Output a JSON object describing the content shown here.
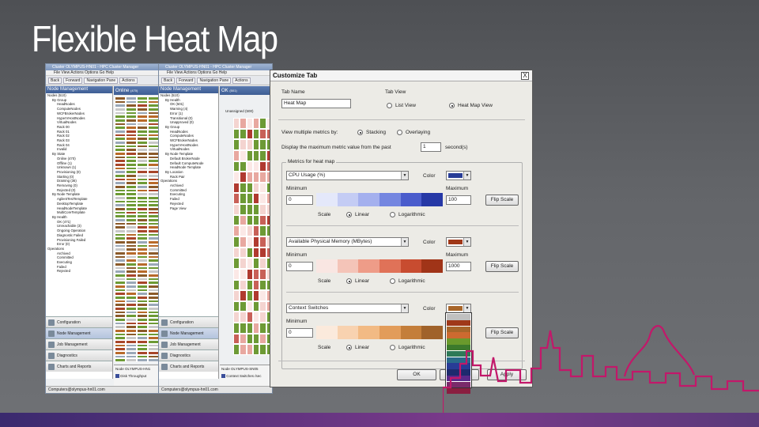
{
  "slide": {
    "title": "Flexible Heat Map"
  },
  "win1": {
    "title": "Cluster OLYMPUS-HN01 - HPC Cluster Manager",
    "menu": "File  View  Actions  Options  Go  Help",
    "toolbar": [
      "Back",
      "Forward",
      "Navigation Pane",
      "Actions",
      "Filters"
    ],
    "nav_header": "Node Management",
    "tree": [
      "Nodes (510)",
      "By Group",
      "HeadNodes",
      "ComputeNodes",
      "WCFBrokerNodes",
      "HyperVHostNodes",
      "VirtualNodes",
      "Rack 00",
      "Rack 01",
      "Rack 02",
      "Rack 03",
      "Rack 04",
      "Invalid",
      "By State",
      "Online (470)",
      "Offline (1)",
      "Unknown (1)",
      "Provisioning (0)",
      "Starting (0)",
      "Draining (36)",
      "Removing (0)",
      "Rejected (0)",
      "By Node Template",
      "AgilentTestTemplate",
      "DesktopTemplate",
      "HeadNodeTemplate",
      "MultiCoreTemplate",
      "By Health",
      "OK (471)",
      "Unreachable (3)",
      "Ongoing Operation",
      "Diagnostic Failed",
      "Provisioning Failed",
      "Error (0)",
      "Operations",
      "Archived",
      "Committed",
      "Executing",
      "Failed",
      "Rejected"
    ],
    "grid_header": "Online",
    "grid_count": "(470)",
    "nav_buttons": [
      "Configuration",
      "Node Management",
      "Job Management",
      "Diagnostics",
      "Charts and Reports"
    ],
    "node_label": "Node",
    "node_value": "OLYMPUS-HN1",
    "legend": "Disk Throughput",
    "status": "Computers@olympus-hn01.com"
  },
  "win2": {
    "title": "Cluster OLYMPUS-HN01 - HPC Cluster Manager",
    "menu": "File  View  Actions  Options  Go  Help",
    "toolbar": [
      "Back",
      "Forward",
      "Navigation Pane",
      "Actions",
      "Filters"
    ],
    "nav_header": "Node Management",
    "tree": [
      "Nodes (510)",
      "By Health",
      "OK (501)",
      "Warning (4)",
      "Error (1)",
      "Transitional (0)",
      "Unapproved (0)",
      "By Group",
      "HeadNodes",
      "ComputeNodes",
      "WCFBrokerNodes",
      "HyperVHostNodes",
      "VirtualNodes",
      "By Node Template",
      "Default BrokerNode",
      "Default ComputeNode",
      "HeadNode Template",
      "By Location",
      "Rack Pair",
      "Operations",
      "Archived",
      "Committed",
      "Executing",
      "Failed",
      "Rejected",
      "Page View"
    ],
    "grid_header": "OK",
    "grid_count": "(501)",
    "subgrid_header": "Unassigned (500)",
    "nav_buttons": [
      "Configuration",
      "Node Management",
      "Job Management",
      "Diagnostics",
      "Charts and Reports"
    ],
    "node_label": "Node",
    "node_value": "OLYMPUS-SN05",
    "legend": "Context Switches /sec",
    "status": "Computers@olympus-hn01.com"
  },
  "dialog": {
    "title": "Customize Tab",
    "close": "X",
    "tab_name_label": "Tab Name",
    "tab_name_value": "Heat Map",
    "tab_view_label": "Tab View",
    "list_view": "List View",
    "heat_map_view": "Heat Map View",
    "view_multiple_label": "View multiple metrics by:",
    "stacking": "Stacking",
    "overlaying": "Overlaying",
    "display_label": "Display the maximum metric value from the past",
    "display_value": "1",
    "display_unit": "second(s)",
    "group_label": "Metrics for heat map",
    "metrics": [
      {
        "name": "CPU Usage (%)",
        "color_label": "Color",
        "color": "#283c96",
        "min_label": "Minimum",
        "min": "0",
        "max_label": "Maximum",
        "max": "100",
        "flip": "Flip Scale",
        "scale_label": "Scale",
        "linear": "Linear",
        "log": "Logarithmic",
        "gradient": [
          "#e4e8fa",
          "#c4ccf4",
          "#a4b0ee",
          "#7486e0",
          "#4a5ccc",
          "#2638a6"
        ]
      },
      {
        "name": "Available Physical Memory (MBytes)",
        "color_label": "Color",
        "color": "#a03818",
        "min_label": "Minimum",
        "min": "0",
        "max_label": "Maximum",
        "max": "1000",
        "flip": "Flip Scale",
        "scale_label": "Scale",
        "linear": "Linear",
        "log": "Logarithmic",
        "gradient": [
          "#f9e6e2",
          "#f4c4b8",
          "#ee9c88",
          "#e07258",
          "#c84c30",
          "#a03418"
        ]
      },
      {
        "name": "Context Switches",
        "color_label": "Color",
        "color": "#a8662a",
        "min_label": "Minimum",
        "min": "0",
        "flip": "Flip Scale",
        "scale_label": "Scale",
        "linear": "Linear",
        "log": "Logarithmic",
        "gradient": [
          "#fbeadc",
          "#f8d2b0",
          "#f2ba84",
          "#e29c5a",
          "#c47e3a",
          "#a0622a"
        ]
      }
    ],
    "color_options": [
      "#c0c0c0",
      "#a03818",
      "#a8662a",
      "#cc6a30",
      "#6a9a2c",
      "#3c7a2c",
      "#2e7a58",
      "#2a6a8a",
      "#283c96",
      "#1e2a6e",
      "#5a2a8a",
      "#7a2a6a",
      "#8a1e40"
    ],
    "ok": "OK",
    "cancel": "Cancel",
    "apply": "Apply"
  }
}
